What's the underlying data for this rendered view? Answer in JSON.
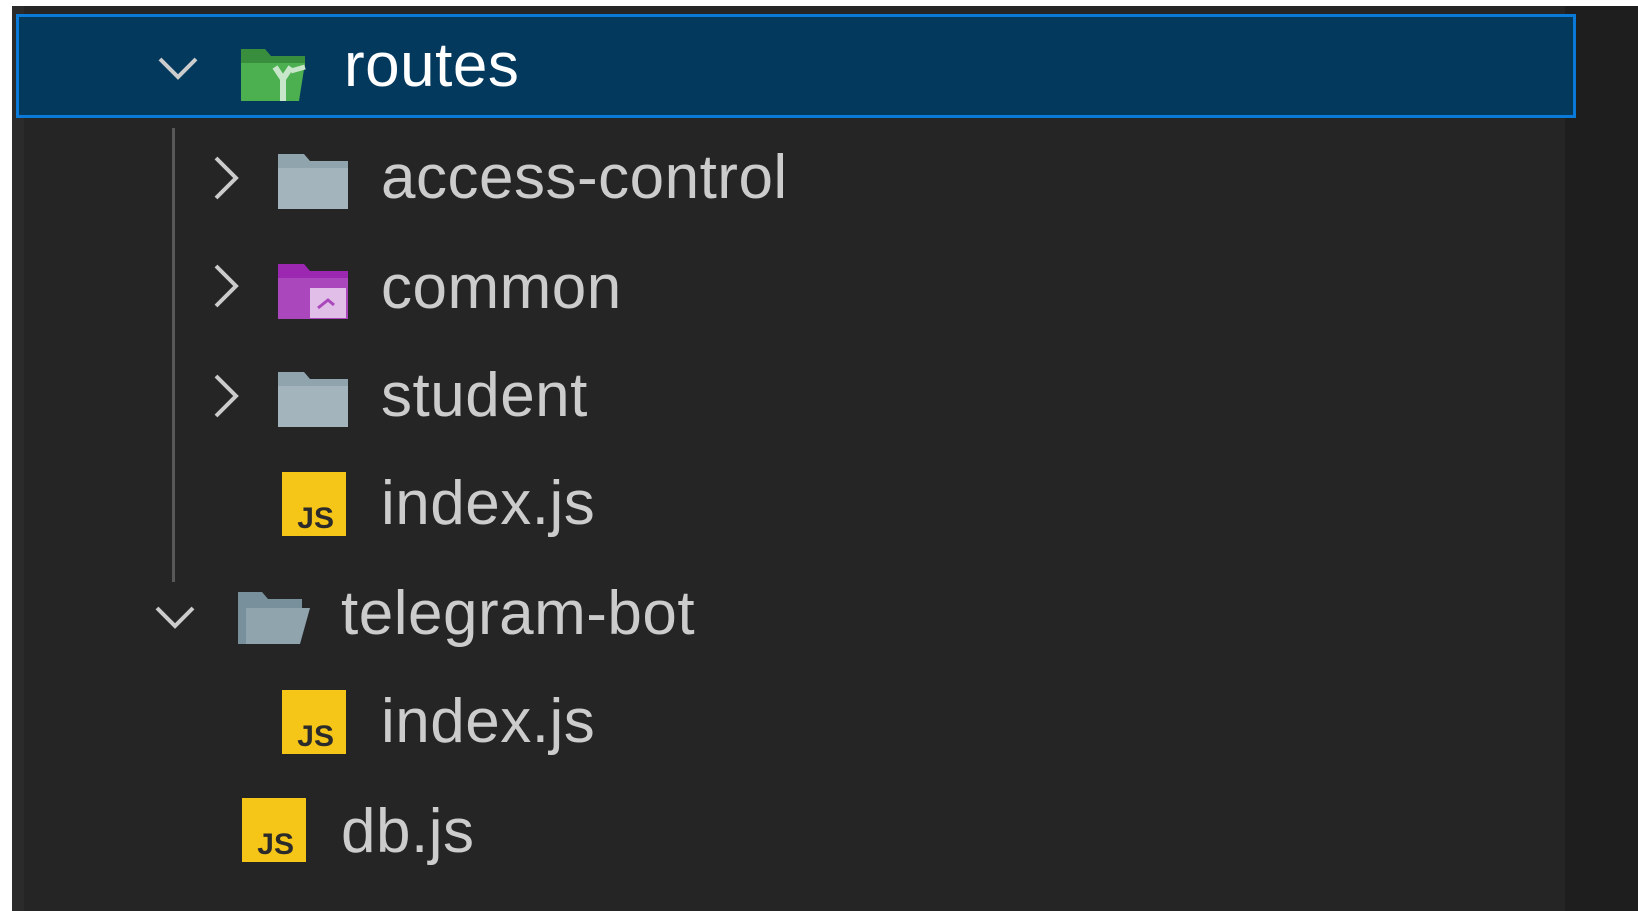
{
  "explorer": {
    "items": [
      {
        "label": "routes",
        "kind": "folder-open",
        "icon": "routes-folder-open-icon",
        "expanded": true,
        "selected": true,
        "depth": 1,
        "icon_color": "#4caf50"
      },
      {
        "label": "access-control",
        "kind": "folder",
        "icon": "folder-icon",
        "expanded": false,
        "depth": 2,
        "icon_color": "#90a4ae"
      },
      {
        "label": "common",
        "kind": "folder",
        "icon": "shared-folder-icon",
        "expanded": false,
        "depth": 2,
        "icon_color": "#ab47bc"
      },
      {
        "label": "student",
        "kind": "folder",
        "icon": "folder-icon",
        "expanded": false,
        "depth": 2,
        "icon_color": "#90a4ae"
      },
      {
        "label": "index.js",
        "kind": "file",
        "icon": "javascript-file-icon",
        "depth": 2,
        "icon_color": "#f5c518",
        "icon_text": "JS"
      },
      {
        "label": "telegram-bot",
        "kind": "folder-open",
        "icon": "folder-open-icon",
        "expanded": true,
        "depth": 1,
        "icon_color": "#90a4ae"
      },
      {
        "label": "index.js",
        "kind": "file",
        "icon": "javascript-file-icon",
        "depth": 2,
        "icon_color": "#f5c518",
        "icon_text": "JS"
      },
      {
        "label": "db.js",
        "kind": "file",
        "icon": "javascript-file-icon",
        "depth": 1,
        "icon_color": "#f5c518",
        "icon_text": "JS"
      }
    ]
  },
  "colors": {
    "panel_background": "#252526",
    "selection_background": "#04395e",
    "selection_border": "#0a7ad9",
    "text": "#cccccc",
    "selected_text": "#ffffff"
  }
}
